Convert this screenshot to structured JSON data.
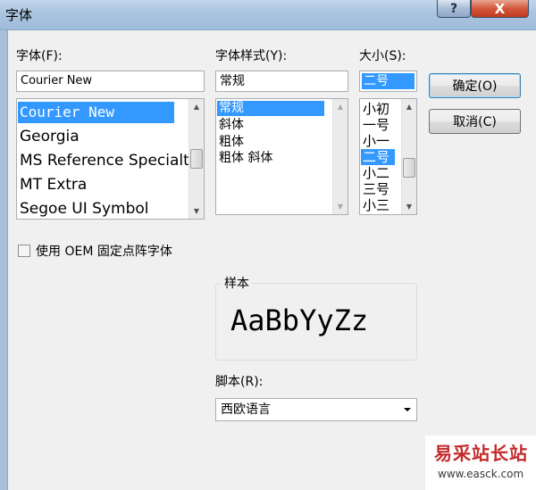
{
  "window": {
    "title": "字体",
    "help_label": "?",
    "close_label": "X"
  },
  "font": {
    "label": "字体(F):",
    "value": "Courier New",
    "items": [
      "Courier New",
      "Georgia",
      "MS Reference Specialt",
      "MT Extra",
      "Segoe UI Symbol"
    ],
    "selected_index": 0
  },
  "style": {
    "label": "字体样式(Y):",
    "value": "常规",
    "items": [
      "常规",
      "斜体",
      "粗体",
      "粗体 斜体"
    ],
    "selected_index": 0
  },
  "size": {
    "label": "大小(S):",
    "value": "二号",
    "items": [
      "小初",
      "一号",
      "小一",
      "二号",
      "小二",
      "三号",
      "小三"
    ],
    "selected_index": 3
  },
  "buttons": {
    "ok_label": "确定(O)",
    "cancel_label": "取消(C)"
  },
  "oem": {
    "label": "使用 OEM 固定点阵字体",
    "checked": false
  },
  "sample": {
    "title": "样本",
    "text": "AaBbYyZz"
  },
  "script": {
    "label": "脚本(R):",
    "value": "西欧语言"
  },
  "watermark": {
    "text": "易采站长站",
    "url": "www.easck.com"
  },
  "colors": {
    "selection": "#3399ff",
    "dialog_bg": "#f0f0f0",
    "title_bar": "#aac4e0",
    "close_button": "#c7472a"
  },
  "icons": {
    "help": "help-icon",
    "close": "close-icon",
    "scroll_up": "scroll-up-arrow-icon",
    "scroll_down": "scroll-down-arrow-icon",
    "dropdown": "chevron-down-icon"
  }
}
